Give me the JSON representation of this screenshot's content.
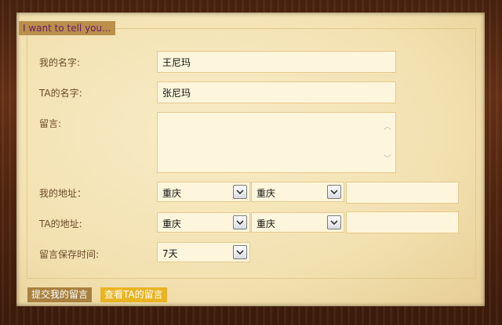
{
  "legend": "I want to tell you...",
  "form": {
    "my_name_label": "我的名字:",
    "my_name_value": "王尼玛",
    "ta_name_label": "TA的名字:",
    "ta_name_value": "张尼玛",
    "message_label": "留言:",
    "message_value": "",
    "my_address_label": "我的地址：",
    "my_province": "重庆",
    "my_city": "重庆",
    "my_address_detail": "",
    "ta_address_label": "TA的地址:",
    "ta_province": "重庆",
    "ta_city": "重庆",
    "ta_address_detail": "",
    "keep_time_label": "留言保存时间:",
    "keep_time_value": "7天"
  },
  "buttons": {
    "submit_label": "提交我的留言",
    "view_label": "查看TA的留言"
  }
}
